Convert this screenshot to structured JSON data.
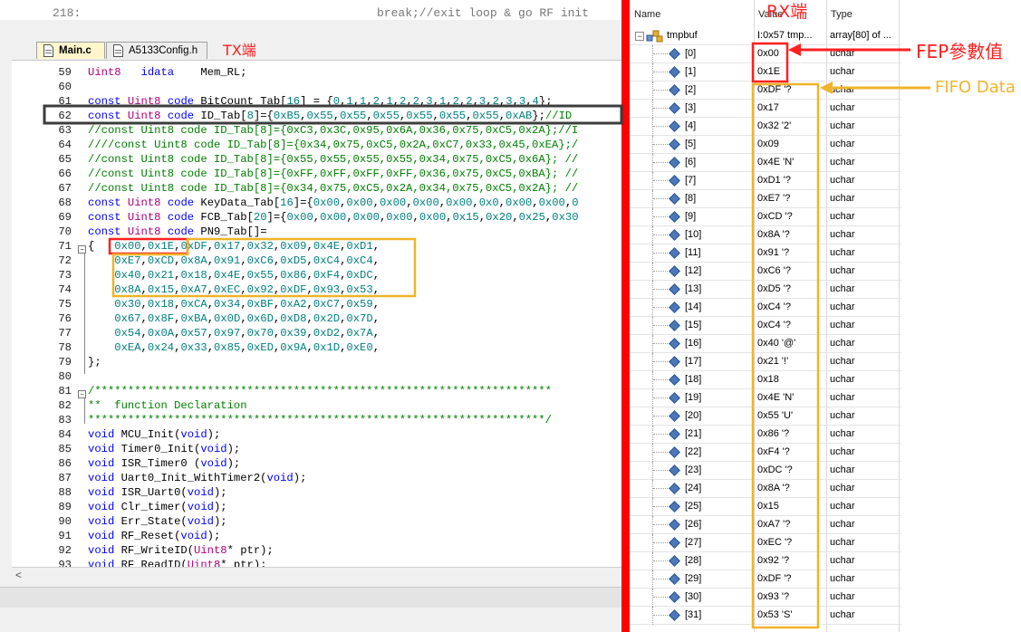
{
  "colors": {
    "annotation_red": "#ff2020",
    "annotation_yellow": "#f0b429",
    "box_dark": "#3c3c3c"
  },
  "editor": {
    "tabs": [
      {
        "label": "Main.c"
      },
      {
        "label": "A5133Config.h"
      }
    ],
    "top_ghost_left": "218:",
    "top_ghost_right": "break;//exit loop & go RF init",
    "lines": [
      {
        "n": "59",
        "text": "Uint8   idata    Mem_RL;"
      },
      {
        "n": "60",
        "text": ""
      },
      {
        "n": "61",
        "text": "const Uint8 code BitCount_Tab[16] = {0,1,1,2,1,2,2,3,1,2,2,3,2,3,3,4};"
      },
      {
        "n": "62",
        "text": "const Uint8 code ID_Tab[8]={0xB5,0x55,0x55,0x55,0x55,0x55,0x55,0xAB};//ID"
      },
      {
        "n": "63",
        "text": "//const Uint8 code ID_Tab[8]={0xC3,0x3C,0x95,0x6A,0x36,0x75,0xC5,0x2A};//I"
      },
      {
        "n": "64",
        "text": "////const Uint8 code ID_Tab[8]={0x34,0x75,0xC5,0x2A,0xC7,0x33,0x45,0xEA};/"
      },
      {
        "n": "65",
        "text": "//const Uint8 code ID_Tab[8]={0x55,0x55,0x55,0x55,0x34,0x75,0xC5,0x6A}; //"
      },
      {
        "n": "66",
        "text": "//const Uint8 code ID_Tab[8]={0xFF,0xFF,0xFF,0xFF,0x36,0x75,0xC5,0xBA}; //"
      },
      {
        "n": "67",
        "text": "//const Uint8 code ID_Tab[8]={0x34,0x75,0xC5,0x2A,0x34,0x75,0xC5,0x2A}; //"
      },
      {
        "n": "68",
        "text": "const Uint8 code KeyData_Tab[16]={0x00,0x00,0x00,0x00,0x00,0x0,0x00,0x00,0"
      },
      {
        "n": "69",
        "text": "const Uint8 code FCB_Tab[20]={0x00,0x00,0x00,0x00,0x00,0x15,0x20,0x25,0x30"
      },
      {
        "n": "70",
        "text": "const Uint8 code PN9_Tab[]="
      },
      {
        "n": "71",
        "text": "{   0x00,0x1E,0xDF,0x17,0x32,0x09,0x4E,0xD1,"
      },
      {
        "n": "72",
        "text": "    0xE7,0xCD,0x8A,0x91,0xC6,0xD5,0xC4,0xC4,"
      },
      {
        "n": "73",
        "text": "    0x40,0x21,0x18,0x4E,0x55,0x86,0xF4,0xDC,"
      },
      {
        "n": "74",
        "text": "    0x8A,0x15,0xA7,0xEC,0x92,0xDF,0x93,0x53,"
      },
      {
        "n": "75",
        "text": "    0x30,0x18,0xCA,0x34,0xBF,0xA2,0xC7,0x59,"
      },
      {
        "n": "76",
        "text": "    0x67,0x8F,0xBA,0x0D,0x6D,0xD8,0x2D,0x7D,"
      },
      {
        "n": "77",
        "text": "    0x54,0x0A,0x57,0x97,0x70,0x39,0xD2,0x7A,"
      },
      {
        "n": "78",
        "text": "    0xEA,0x24,0x33,0x85,0xED,0x9A,0x1D,0xE0,"
      },
      {
        "n": "79",
        "text": "};"
      },
      {
        "n": "80",
        "text": ""
      },
      {
        "n": "81",
        "text": "/*********************************************************************"
      },
      {
        "n": "82",
        "text": "**  function Declaration"
      },
      {
        "n": "83",
        "text": "*********************************************************************/"
      },
      {
        "n": "84",
        "text": "void MCU_Init(void);"
      },
      {
        "n": "85",
        "text": "void Timer0_Init(void);"
      },
      {
        "n": "86",
        "text": "void ISR_Timer0 (void);"
      },
      {
        "n": "87",
        "text": "void Uart0_Init_WithTimer2(void);"
      },
      {
        "n": "88",
        "text": "void ISR_Uart0(void);"
      },
      {
        "n": "89",
        "text": "void Clr_timer(void);"
      },
      {
        "n": "90",
        "text": "void Err_State(void);"
      },
      {
        "n": "91",
        "text": "void RF_Reset(void);"
      },
      {
        "n": "92",
        "text": "void RF_WriteID(Uint8* ptr);"
      },
      {
        "n": "93",
        "text": "void RF_ReadID(Uint8* ptr);"
      }
    ]
  },
  "watch": {
    "headers": {
      "name": "Name",
      "value": "Value",
      "type": "Type"
    },
    "root": {
      "name": "tmpbuf",
      "value": "I:0x57 tmp...",
      "type": "array[80] of ..."
    },
    "items": [
      {
        "index": "[0]",
        "value": "0x00",
        "type": "uchar"
      },
      {
        "index": "[1]",
        "value": "0x1E",
        "type": "uchar"
      },
      {
        "index": "[2]",
        "value": "0xDF '?",
        "type": "uchar"
      },
      {
        "index": "[3]",
        "value": "0x17",
        "type": "uchar"
      },
      {
        "index": "[4]",
        "value": "0x32 '2'",
        "type": "uchar"
      },
      {
        "index": "[5]",
        "value": "0x09",
        "type": "uchar"
      },
      {
        "index": "[6]",
        "value": "0x4E 'N'",
        "type": "uchar"
      },
      {
        "index": "[7]",
        "value": "0xD1 '?",
        "type": "uchar"
      },
      {
        "index": "[8]",
        "value": "0xE7 '?",
        "type": "uchar"
      },
      {
        "index": "[9]",
        "value": "0xCD '?",
        "type": "uchar"
      },
      {
        "index": "[10]",
        "value": "0x8A '?",
        "type": "uchar"
      },
      {
        "index": "[11]",
        "value": "0x91 '?",
        "type": "uchar"
      },
      {
        "index": "[12]",
        "value": "0xC6 '?",
        "type": "uchar"
      },
      {
        "index": "[13]",
        "value": "0xD5 '?",
        "type": "uchar"
      },
      {
        "index": "[14]",
        "value": "0xC4 '?",
        "type": "uchar"
      },
      {
        "index": "[15]",
        "value": "0xC4 '?",
        "type": "uchar"
      },
      {
        "index": "[16]",
        "value": "0x40 '@'",
        "type": "uchar"
      },
      {
        "index": "[17]",
        "value": "0x21 '!'",
        "type": "uchar"
      },
      {
        "index": "[18]",
        "value": "0x18",
        "type": "uchar"
      },
      {
        "index": "[19]",
        "value": "0x4E 'N'",
        "type": "uchar"
      },
      {
        "index": "[20]",
        "value": "0x55 'U'",
        "type": "uchar"
      },
      {
        "index": "[21]",
        "value": "0x86 '?",
        "type": "uchar"
      },
      {
        "index": "[22]",
        "value": "0xF4 '?",
        "type": "uchar"
      },
      {
        "index": "[23]",
        "value": "0xDC '?",
        "type": "uchar"
      },
      {
        "index": "[24]",
        "value": "0x8A '?",
        "type": "uchar"
      },
      {
        "index": "[25]",
        "value": "0x15",
        "type": "uchar"
      },
      {
        "index": "[26]",
        "value": "0xA7 '?",
        "type": "uchar"
      },
      {
        "index": "[27]",
        "value": "0xEC '?",
        "type": "uchar"
      },
      {
        "index": "[28]",
        "value": "0x92 '?",
        "type": "uchar"
      },
      {
        "index": "[29]",
        "value": "0xDF '?",
        "type": "uchar"
      },
      {
        "index": "[30]",
        "value": "0x93 '?",
        "type": "uchar"
      },
      {
        "index": "[31]",
        "value": "0x53 'S'",
        "type": "uchar"
      }
    ]
  },
  "annotations": {
    "tx_label": "TX端",
    "rx_label": "RX端",
    "fep_label": "FEP參數值",
    "fifo_label": "FIFO Data"
  }
}
